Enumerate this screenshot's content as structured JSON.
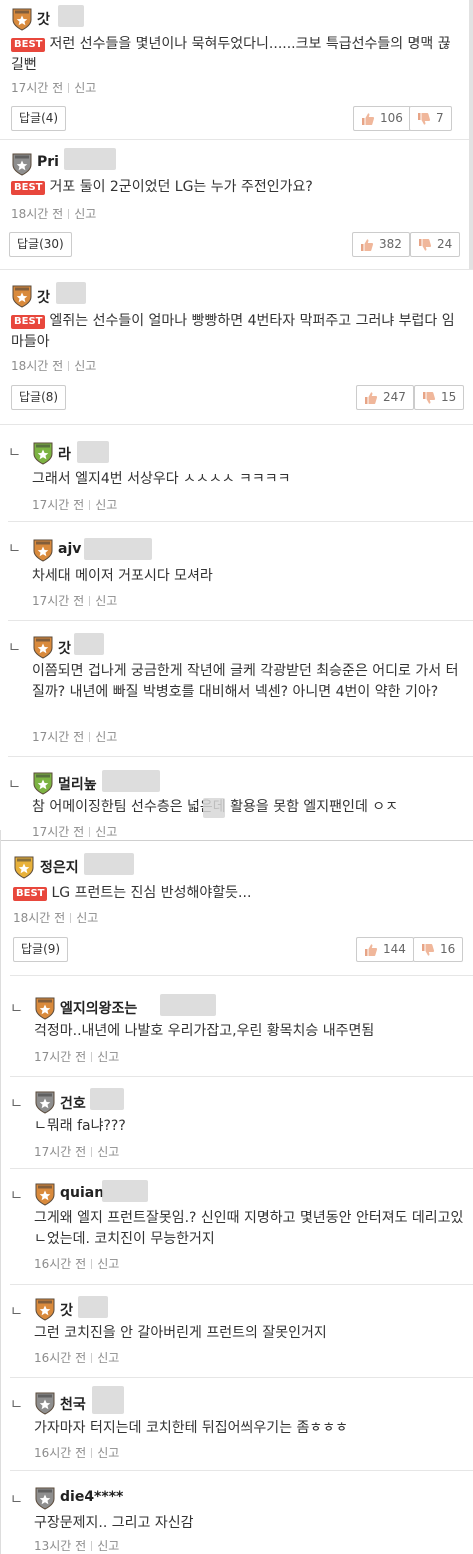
{
  "comments": [
    {
      "id": "c1",
      "badge": "orange",
      "name": "갓",
      "text": "저런 선수들을 몇년이나 묵혀두었다니......크보 특급선수들의 명맥 끊길뻔",
      "best": "BEST",
      "time": "17시간 전",
      "report": "신고",
      "reply": "답글(4)",
      "up": "106",
      "down": "7"
    },
    {
      "id": "c2",
      "badge": "silver",
      "name": "Pri",
      "text": "거포 둘이 2군이었던 LG는 누가 주전인가요?",
      "best": "BEST",
      "time": "18시간 전",
      "report": "신고",
      "reply": "답글(30)",
      "up": "382",
      "down": "24"
    },
    {
      "id": "c3",
      "badge": "orange",
      "name": "갓",
      "text": "엘쥐는 선수들이 얼마나 빵빵하면 4번타자 막퍼주고 그러냐 부럽다 임마들아",
      "best": "BEST",
      "time": "18시간 전",
      "report": "신고",
      "reply": "답글(8)",
      "up": "247",
      "down": "15"
    },
    {
      "id": "r1",
      "badge": "green",
      "name": "라",
      "text": "그래서 엘지4번 서상우다 ㅅㅅㅅㅅ ㅋㅋㅋㅋ",
      "time": "17시간 전",
      "report": "신고"
    },
    {
      "id": "r2",
      "badge": "orange",
      "name": "ajv",
      "text": "차세대 메이저 거포시다 모셔라",
      "time": "17시간 전",
      "report": "신고"
    },
    {
      "id": "r3",
      "badge": "orange",
      "name": "갓",
      "text": "이쯤되면 겁나게 궁금한게 작년에 글케 각광받던 최승준은 어디로 가서 터질까? 내년에 빠질 박병호를 대비해서 넥센? 아니면 4번이 약한 기아?",
      "time": "17시간 전",
      "report": "신고"
    },
    {
      "id": "r4",
      "badge": "green",
      "name": "멀리높",
      "text": "참 어메이징한팀 선수층은 넓은데 활용을 못함 엘지팬인데 ㅇㅈ",
      "time": "17시간 전",
      "report": "신고"
    },
    {
      "id": "c4",
      "badge": "gold",
      "name": "정은지",
      "text": "LG 프런트는 진심 반성해야할듯...",
      "best": "BEST",
      "time": "18시간 전",
      "report": "신고",
      "reply": "답글(9)",
      "up": "144",
      "down": "16"
    },
    {
      "id": "r5",
      "badge": "orange",
      "name": "엘지의왕조는",
      "text": "걱정마..내년에 나발호 우리가잡고,우린 황목치승 내주면됨",
      "time": "17시간 전",
      "report": "신고"
    },
    {
      "id": "r6",
      "badge": "silver",
      "name": "건호",
      "text": "ㄴ뭐래 fa냐???",
      "time": "17시간 전",
      "report": "신고"
    },
    {
      "id": "r7",
      "badge": "orange",
      "name": "quian",
      "text": "그게왜 엘지 프런트잘못임.? 신인때 지명하고 몇년동안 안터져도 데리고있ㄴ었는데. 코치진이 무능한거지",
      "time": "16시간 전",
      "report": "신고"
    },
    {
      "id": "r8",
      "badge": "orange",
      "name": "갓",
      "text": "그런 코치진을 안 갈아버린게 프런트의 잘못인거지",
      "time": "16시간 전",
      "report": "신고"
    },
    {
      "id": "r9",
      "badge": "silver",
      "name": "천국",
      "text": "가자마자 터지는데 코치한테 뒤집어씌우기는 좀ㅎㅎㅎ",
      "time": "16시간 전",
      "report": "신고"
    },
    {
      "id": "r10",
      "badge": "silver",
      "name": "die4****",
      "text": "구장문제지.. 그리고 자신감",
      "time": "13시간 전",
      "report": "신고"
    }
  ],
  "reply_arrow": "ㄴ",
  "colors": {
    "best": "#e8473c",
    "orange_badge": "#d98a3c",
    "silver_badge": "#8e8e8e",
    "green_badge": "#7cb342",
    "gold_badge": "#e8b13a"
  },
  "icons": {
    "up": "thumbs-up-icon",
    "down": "thumbs-down-icon"
  }
}
